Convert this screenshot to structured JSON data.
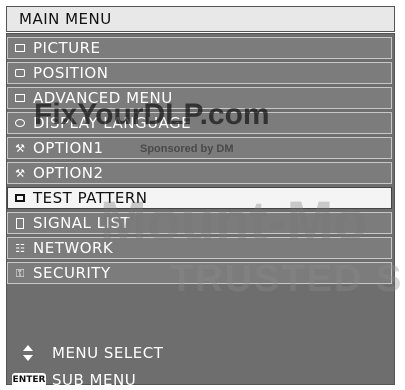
{
  "title": "MAIN MENU",
  "menu": {
    "items": [
      {
        "label": "PICTURE",
        "icon": "picture-icon",
        "selected": false
      },
      {
        "label": "POSITION",
        "icon": "position-icon",
        "selected": false
      },
      {
        "label": "ADVANCED MENU",
        "icon": "advanced-menu-icon",
        "selected": false
      },
      {
        "label": "DISPLAY LANGUAGE",
        "icon": "display-language-icon",
        "selected": false
      },
      {
        "label": "OPTION1",
        "icon": "wrench-icon",
        "selected": false
      },
      {
        "label": "OPTION2",
        "icon": "wrench-icon",
        "selected": false
      },
      {
        "label": "TEST PATTERN",
        "icon": "test-pattern-icon",
        "selected": true
      },
      {
        "label": "SIGNAL LIST",
        "icon": "signal-list-icon",
        "selected": false
      },
      {
        "label": "NETWORK",
        "icon": "network-icon",
        "selected": false
      },
      {
        "label": "SECURITY",
        "icon": "security-icon",
        "selected": false
      }
    ]
  },
  "footer": {
    "menu_select": "MENU SELECT",
    "sub_menu": "SUB MENU",
    "enter_badge": "ENTER"
  },
  "watermarks": {
    "site": "FixYourDLP.com",
    "sponsored": "Sponsored by DM",
    "mount": "Mount-Mo",
    "trusted": "TRUSTED SOUR"
  },
  "colors": {
    "panel": "#6e6e6e",
    "selected_row": "#f4f4f4",
    "text": "#ffffff"
  }
}
